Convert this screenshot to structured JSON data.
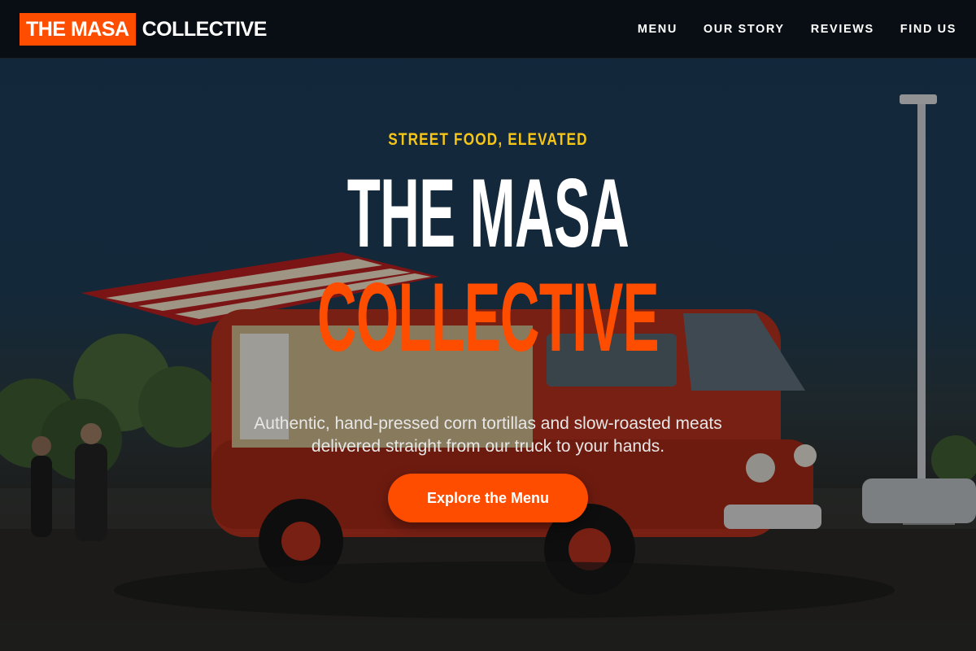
{
  "header": {
    "logo_highlight": "THE MASA",
    "logo_rest": "COLLECTIVE",
    "nav": [
      {
        "label": "MENU"
      },
      {
        "label": "OUR STORY"
      },
      {
        "label": "REVIEWS"
      },
      {
        "label": "FIND US"
      }
    ]
  },
  "hero": {
    "eyebrow": "STREET FOOD, ELEVATED",
    "title_line_1": "THE MASA",
    "title_line_2": "COLLECTIVE",
    "subtitle": "Authentic, hand-pressed corn tortillas and slow-roasted meats delivered straight from our truck to your hands.",
    "cta_label": "Explore the Menu",
    "background_image": "food-truck-photo"
  },
  "colors": {
    "accent": "#ff4d00",
    "eyebrow": "#f5c518",
    "header_bg": "#080c10",
    "text": "#ffffff"
  }
}
